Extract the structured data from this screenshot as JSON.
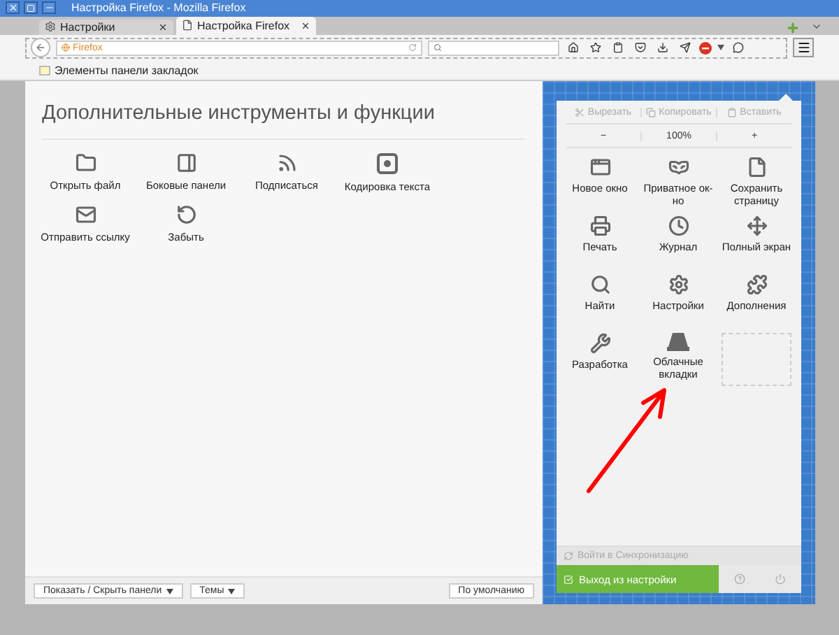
{
  "window": {
    "title": "Настройка Firefox - Mozilla Firefox"
  },
  "tabs": [
    {
      "label": "Настройки",
      "selected": false
    },
    {
      "label": "Настройка Firefox",
      "selected": true
    }
  ],
  "address_bar": {
    "identity": "Firefox"
  },
  "bookmarks_bar": {
    "label": "Элементы панели закладок"
  },
  "palette": {
    "title": "Дополнительные инструменты и функции",
    "items": [
      {
        "label": "Открыть файл"
      },
      {
        "label": "Боковые панели"
      },
      {
        "label": "Подписаться"
      },
      {
        "label": "Кодировка текста"
      },
      {
        "label": "Отправить ссылку"
      },
      {
        "label": "Забыть"
      }
    ]
  },
  "footer": {
    "buttons": [
      {
        "label": "Показать / Скрыть панели"
      },
      {
        "label": "Темы"
      }
    ],
    "restore": "По умолчанию"
  },
  "menu_panel": {
    "edit": [
      {
        "label": "Вырезать",
        "disabled": true
      },
      {
        "label": "Копировать",
        "disabled": true
      },
      {
        "label": "Вставить",
        "disabled": true
      }
    ],
    "zoom": {
      "out": "−",
      "level": "100%",
      "in": "+"
    },
    "items": [
      {
        "label": "Новое окно"
      },
      {
        "label": "Приватное ок-но"
      },
      {
        "label": "Сохранить страницу"
      },
      {
        "label": "Печать"
      },
      {
        "label": "Журнал"
      },
      {
        "label": "Полный экран"
      },
      {
        "label": "Найти"
      },
      {
        "label": "Настройки"
      },
      {
        "label": "Дополнения"
      },
      {
        "label": "Разработка"
      },
      {
        "label": "Облачные вкладки"
      }
    ],
    "sync": {
      "label": "Войти в Синхронизацию",
      "disabled": true
    },
    "exit": "Выход из настройки"
  }
}
